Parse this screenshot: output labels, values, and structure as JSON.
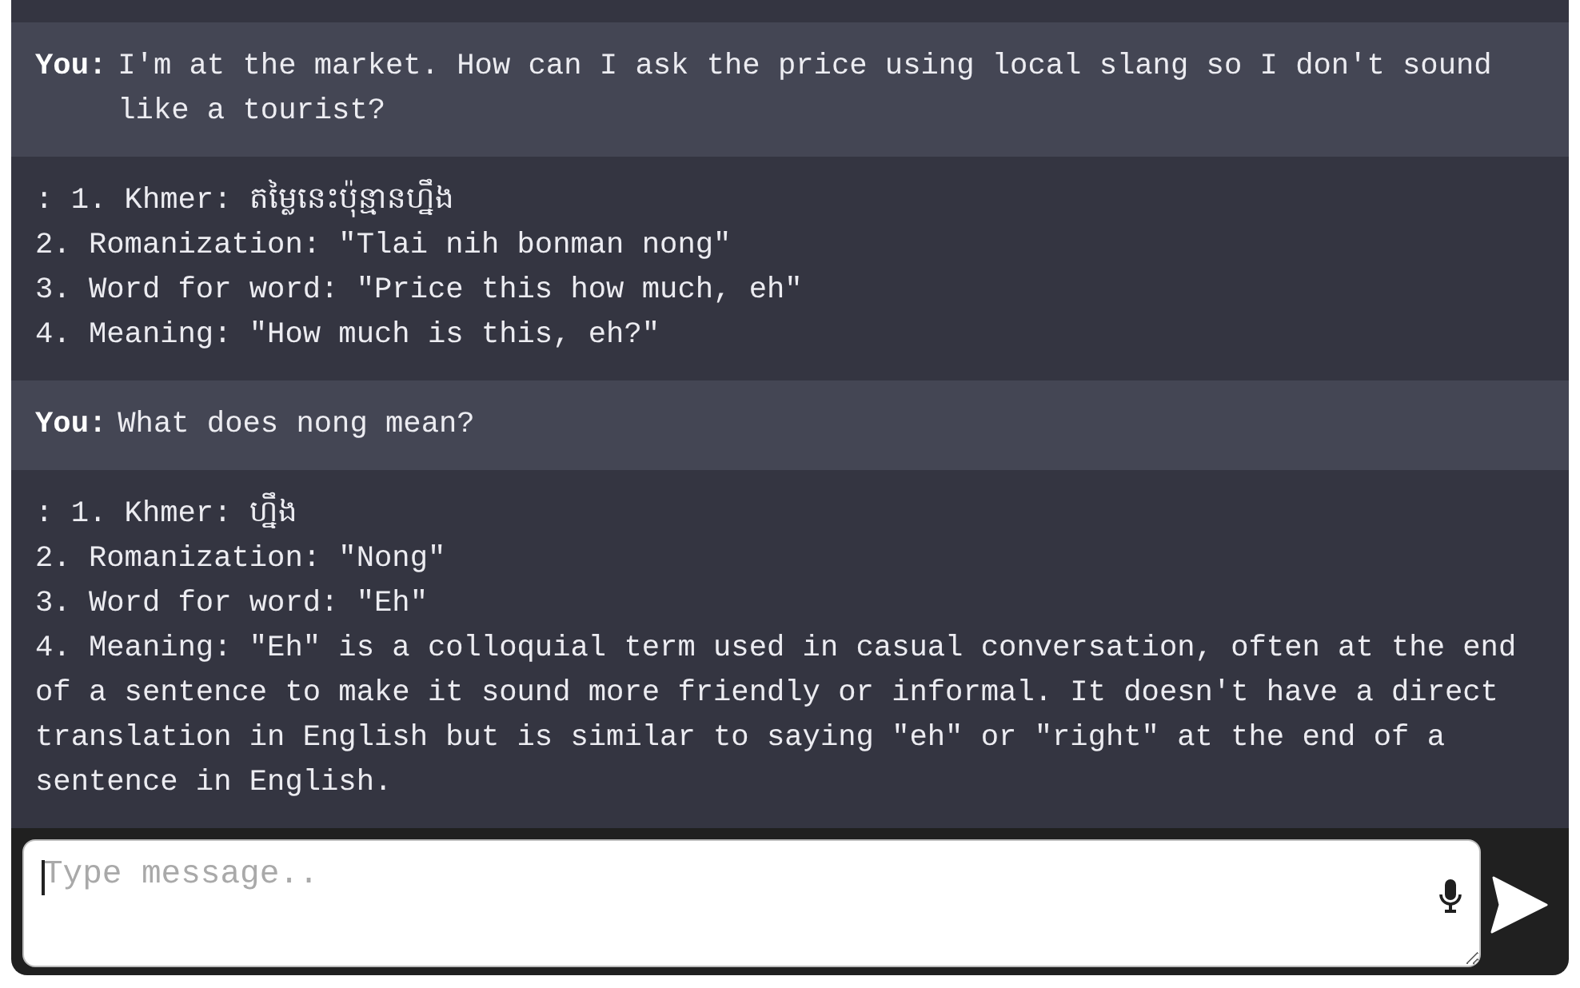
{
  "messages": [
    {
      "kind": "user",
      "sender": "You:",
      "text": "I'm at the market. How can I ask the price using local slang so I don't sound like a tourist?"
    },
    {
      "kind": "assistant",
      "lines": [
        ": 1. Khmer: តម្លៃនេះប៉ុន្មានហ្នឹង",
        "2. Romanization: \"Tlai nih bonman nong\"",
        "3. Word for word: \"Price this how much, eh\"",
        "4. Meaning: \"How much is this, eh?\""
      ]
    },
    {
      "kind": "user",
      "sender": "You:",
      "text": "What does nong mean?"
    },
    {
      "kind": "assistant",
      "lines": [
        ": 1. Khmer: ហ្នឹង",
        "2. Romanization: \"Nong\"",
        "3. Word for word: \"Eh\"",
        "4. Meaning: \"Eh\" is a colloquial term used in casual conversation, often at the end of a sentence to make it sound more friendly or informal. It doesn't have a direct translation in English but is similar to saying \"eh\" or \"right\" at the end of a sentence in English."
      ]
    }
  ],
  "composer": {
    "placeholder": "Type message..",
    "focused": true
  }
}
